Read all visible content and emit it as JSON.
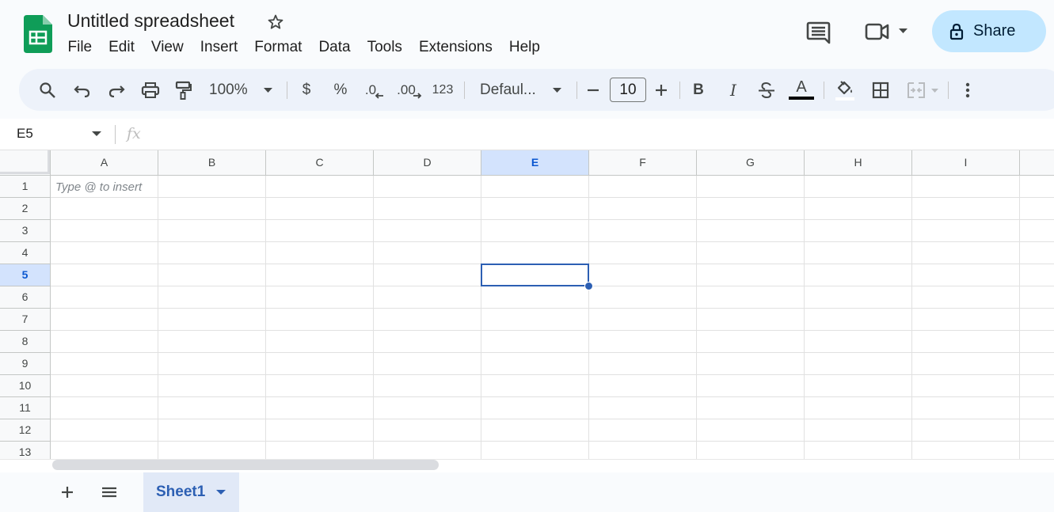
{
  "colors": {
    "accent": "#2c5fb3",
    "selection_header": "#d3e3fd",
    "share_bg": "#c2e7ff",
    "toolbar_bg": "#edf2fa",
    "logo_green": "#0f9d58"
  },
  "header": {
    "doc_title": "Untitled spreadsheet",
    "menu": [
      "File",
      "Edit",
      "View",
      "Insert",
      "Format",
      "Data",
      "Tools",
      "Extensions",
      "Help"
    ],
    "share_label": "Share",
    "icons": [
      "sheets-logo-icon",
      "star-icon",
      "comment-icon",
      "video-call-icon",
      "lock-icon"
    ]
  },
  "toolbar": {
    "zoom": "100%",
    "currency": "$",
    "percent": "%",
    "decrease_decimal": ".0",
    "increase_decimal": ".00",
    "number_format": "123",
    "font": "Defaul...",
    "font_size": "10",
    "bold": "B",
    "italic": "I",
    "text_color": "A"
  },
  "formula_bar": {
    "name_box": "E5",
    "fx": "fx",
    "formula": ""
  },
  "grid": {
    "columns": [
      "A",
      "B",
      "C",
      "D",
      "E",
      "F",
      "G",
      "H",
      "I"
    ],
    "rows": [
      "1",
      "2",
      "3",
      "4",
      "5",
      "6",
      "7",
      "8",
      "9",
      "10",
      "11",
      "12",
      "13"
    ],
    "selected_cell": "E5",
    "selected_column": "E",
    "selected_row": "5",
    "placeholder_hint": "Type @ to insert"
  },
  "sheets": {
    "tabs": [
      "Sheet1"
    ],
    "active": "Sheet1"
  }
}
